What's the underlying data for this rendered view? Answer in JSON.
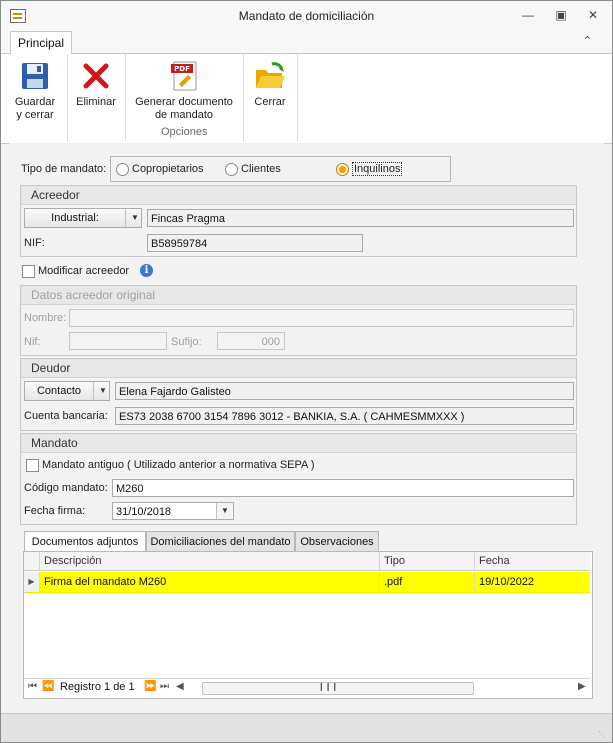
{
  "window": {
    "title": "Mandato de domiciliación"
  },
  "ribbon": {
    "tab": "Principal",
    "buttons": {
      "save_line1": "Guardar",
      "save_line2": "y cerrar",
      "delete": "Eliminar",
      "generate_line1": "Generar documento",
      "generate_line2": "de mandato",
      "close": "Cerrar"
    },
    "group_label": "Opciones",
    "pdf_badge": "PDF"
  },
  "tipo_mandato": {
    "label": "Tipo de mandato:",
    "options": [
      "Copropietarios",
      "Clientes",
      "Inquilinos"
    ],
    "selected": "Inquilinos"
  },
  "acreedor": {
    "header": "Acreedor",
    "type_value": "Industrial:",
    "name": "Fincas Pragma",
    "nif_label": "NIF:",
    "nif": "B58959784"
  },
  "modificar_acreedor": {
    "label": "Modificar acreedor",
    "checked": false
  },
  "acreedor_original": {
    "header": "Datos acreedor original",
    "nombre_label": "Nombre:",
    "nif_label": "Nif:",
    "sufijo_label": "Sufijo:",
    "sufijo_value": "000"
  },
  "deudor": {
    "header": "Deudor",
    "type_value": "Contacto",
    "name": "Elena Fajardo Galisteo",
    "cuenta_label": "Cuenta bancaria:",
    "cuenta": "ES73 2038 6700 3154 7896 3012 - BANKIA, S.A. ( CAHMESMMXXX )"
  },
  "mandato": {
    "header": "Mandato",
    "antiguo_label": "Mandato antiguo ( Utilizado anterior a normativa SEPA )",
    "codigo_label": "Código mandato:",
    "codigo": "M260",
    "fecha_label": "Fecha firma:",
    "fecha": "31/10/2018"
  },
  "detail_tabs": [
    "Documentos adjuntos",
    "Domiciliaciones del mandato",
    "Observaciones"
  ],
  "grid": {
    "columns": [
      "Descripción",
      "Tipo",
      "Fecha"
    ],
    "rows": [
      {
        "descripcion": "Firma del mandato M260",
        "tipo": ".pdf",
        "fecha": "19/10/2022"
      }
    ],
    "navigator": "Registro 1 de 1"
  },
  "colors": {
    "selected_row": "#ffff00",
    "radio_selected": "#f0a000",
    "info_icon": "#3a78d0"
  }
}
